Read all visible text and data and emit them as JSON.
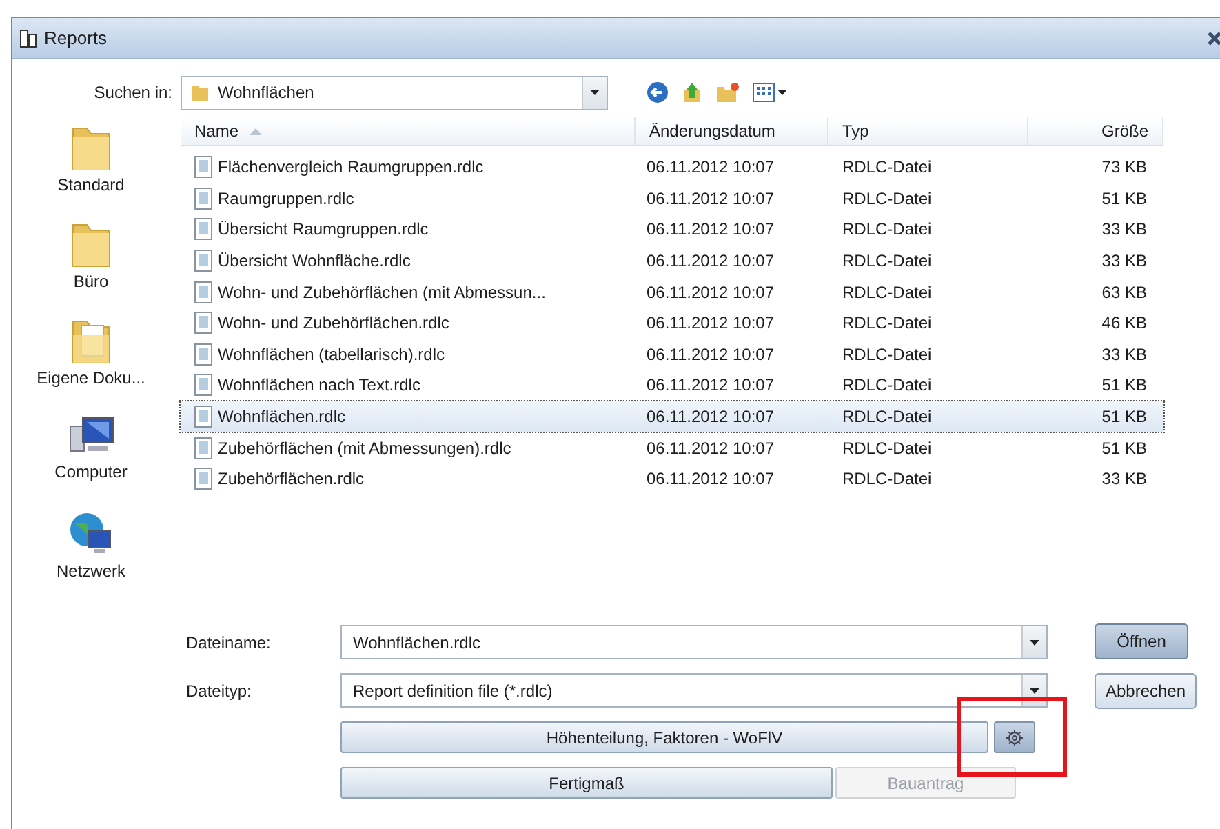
{
  "window": {
    "title": "Reports"
  },
  "look_in": {
    "label": "Suchen in:",
    "value": "Wohnflächen"
  },
  "places": [
    {
      "label": "Standard",
      "kind": "folder"
    },
    {
      "label": "Büro",
      "kind": "folder"
    },
    {
      "label": "Eigene Doku...",
      "kind": "documents"
    },
    {
      "label": "Computer",
      "kind": "computer"
    },
    {
      "label": "Netzwerk",
      "kind": "network"
    }
  ],
  "table": {
    "columns": [
      {
        "label": "Name",
        "sorted": true
      },
      {
        "label": "Änderungsdatum",
        "sorted": false
      },
      {
        "label": "Typ",
        "sorted": false
      },
      {
        "label": "Größe",
        "sorted": false
      }
    ],
    "rows": [
      {
        "name": "Flächenvergleich Raumgruppen.rdlc",
        "date": "06.11.2012 10:07",
        "type": "RDLC-Datei",
        "size": "73 KB",
        "selected": false
      },
      {
        "name": "Raumgruppen.rdlc",
        "date": "06.11.2012 10:07",
        "type": "RDLC-Datei",
        "size": "51 KB",
        "selected": false
      },
      {
        "name": "Übersicht Raumgruppen.rdlc",
        "date": "06.11.2012 10:07",
        "type": "RDLC-Datei",
        "size": "33 KB",
        "selected": false
      },
      {
        "name": "Übersicht Wohnfläche.rdlc",
        "date": "06.11.2012 10:07",
        "type": "RDLC-Datei",
        "size": "33 KB",
        "selected": false
      },
      {
        "name": "Wohn- und Zubehörflächen (mit Abmessun...",
        "date": "06.11.2012 10:07",
        "type": "RDLC-Datei",
        "size": "63 KB",
        "selected": false
      },
      {
        "name": "Wohn- und Zubehörflächen.rdlc",
        "date": "06.11.2012 10:07",
        "type": "RDLC-Datei",
        "size": "46 KB",
        "selected": false
      },
      {
        "name": "Wohnflächen (tabellarisch).rdlc",
        "date": "06.11.2012 10:07",
        "type": "RDLC-Datei",
        "size": "33 KB",
        "selected": false
      },
      {
        "name": "Wohnflächen nach Text.rdlc",
        "date": "06.11.2012 10:07",
        "type": "RDLC-Datei",
        "size": "51 KB",
        "selected": false
      },
      {
        "name": "Wohnflächen.rdlc",
        "date": "06.11.2012 10:07",
        "type": "RDLC-Datei",
        "size": "51 KB",
        "selected": true
      },
      {
        "name": "Zubehörflächen (mit Abmessungen).rdlc",
        "date": "06.11.2012 10:07",
        "type": "RDLC-Datei",
        "size": "51 KB",
        "selected": false
      },
      {
        "name": "Zubehörflächen.rdlc",
        "date": "06.11.2012 10:07",
        "type": "RDLC-Datei",
        "size": "33 KB",
        "selected": false
      }
    ]
  },
  "file_name": {
    "label": "Dateiname:",
    "value": "Wohnflächen.rdlc"
  },
  "file_type": {
    "label": "Dateityp:",
    "value": "Report definition file (*.rdlc)"
  },
  "open_button": {
    "label": "Öffnen"
  },
  "cancel_button": {
    "label": "Abbrechen"
  },
  "option_buttons": [
    {
      "label": "Höhenteilung, Faktoren - WoFlV",
      "disabled": false
    },
    {
      "label": "Fertigmaß",
      "disabled": false
    },
    {
      "label": "Bauantrag",
      "disabled": true
    }
  ]
}
